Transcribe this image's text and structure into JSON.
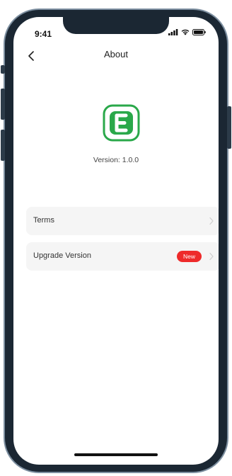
{
  "status_bar": {
    "time": "9:41",
    "icons": [
      "signal-icon",
      "wifi-icon",
      "battery-icon"
    ]
  },
  "header": {
    "title": "About",
    "back_icon": "chevron-left-icon"
  },
  "app": {
    "logo_icon": "app-logo-icon",
    "logo_color": "#2aa84a",
    "version_text": "Version: 1.0.0"
  },
  "menu": {
    "items": [
      {
        "label": "Terms",
        "icon": "chevron-right-icon"
      },
      {
        "label": "Upgrade Version",
        "badge": "New",
        "badge_color": "#ee2a2a",
        "icon": "chevron-right-icon"
      }
    ]
  }
}
